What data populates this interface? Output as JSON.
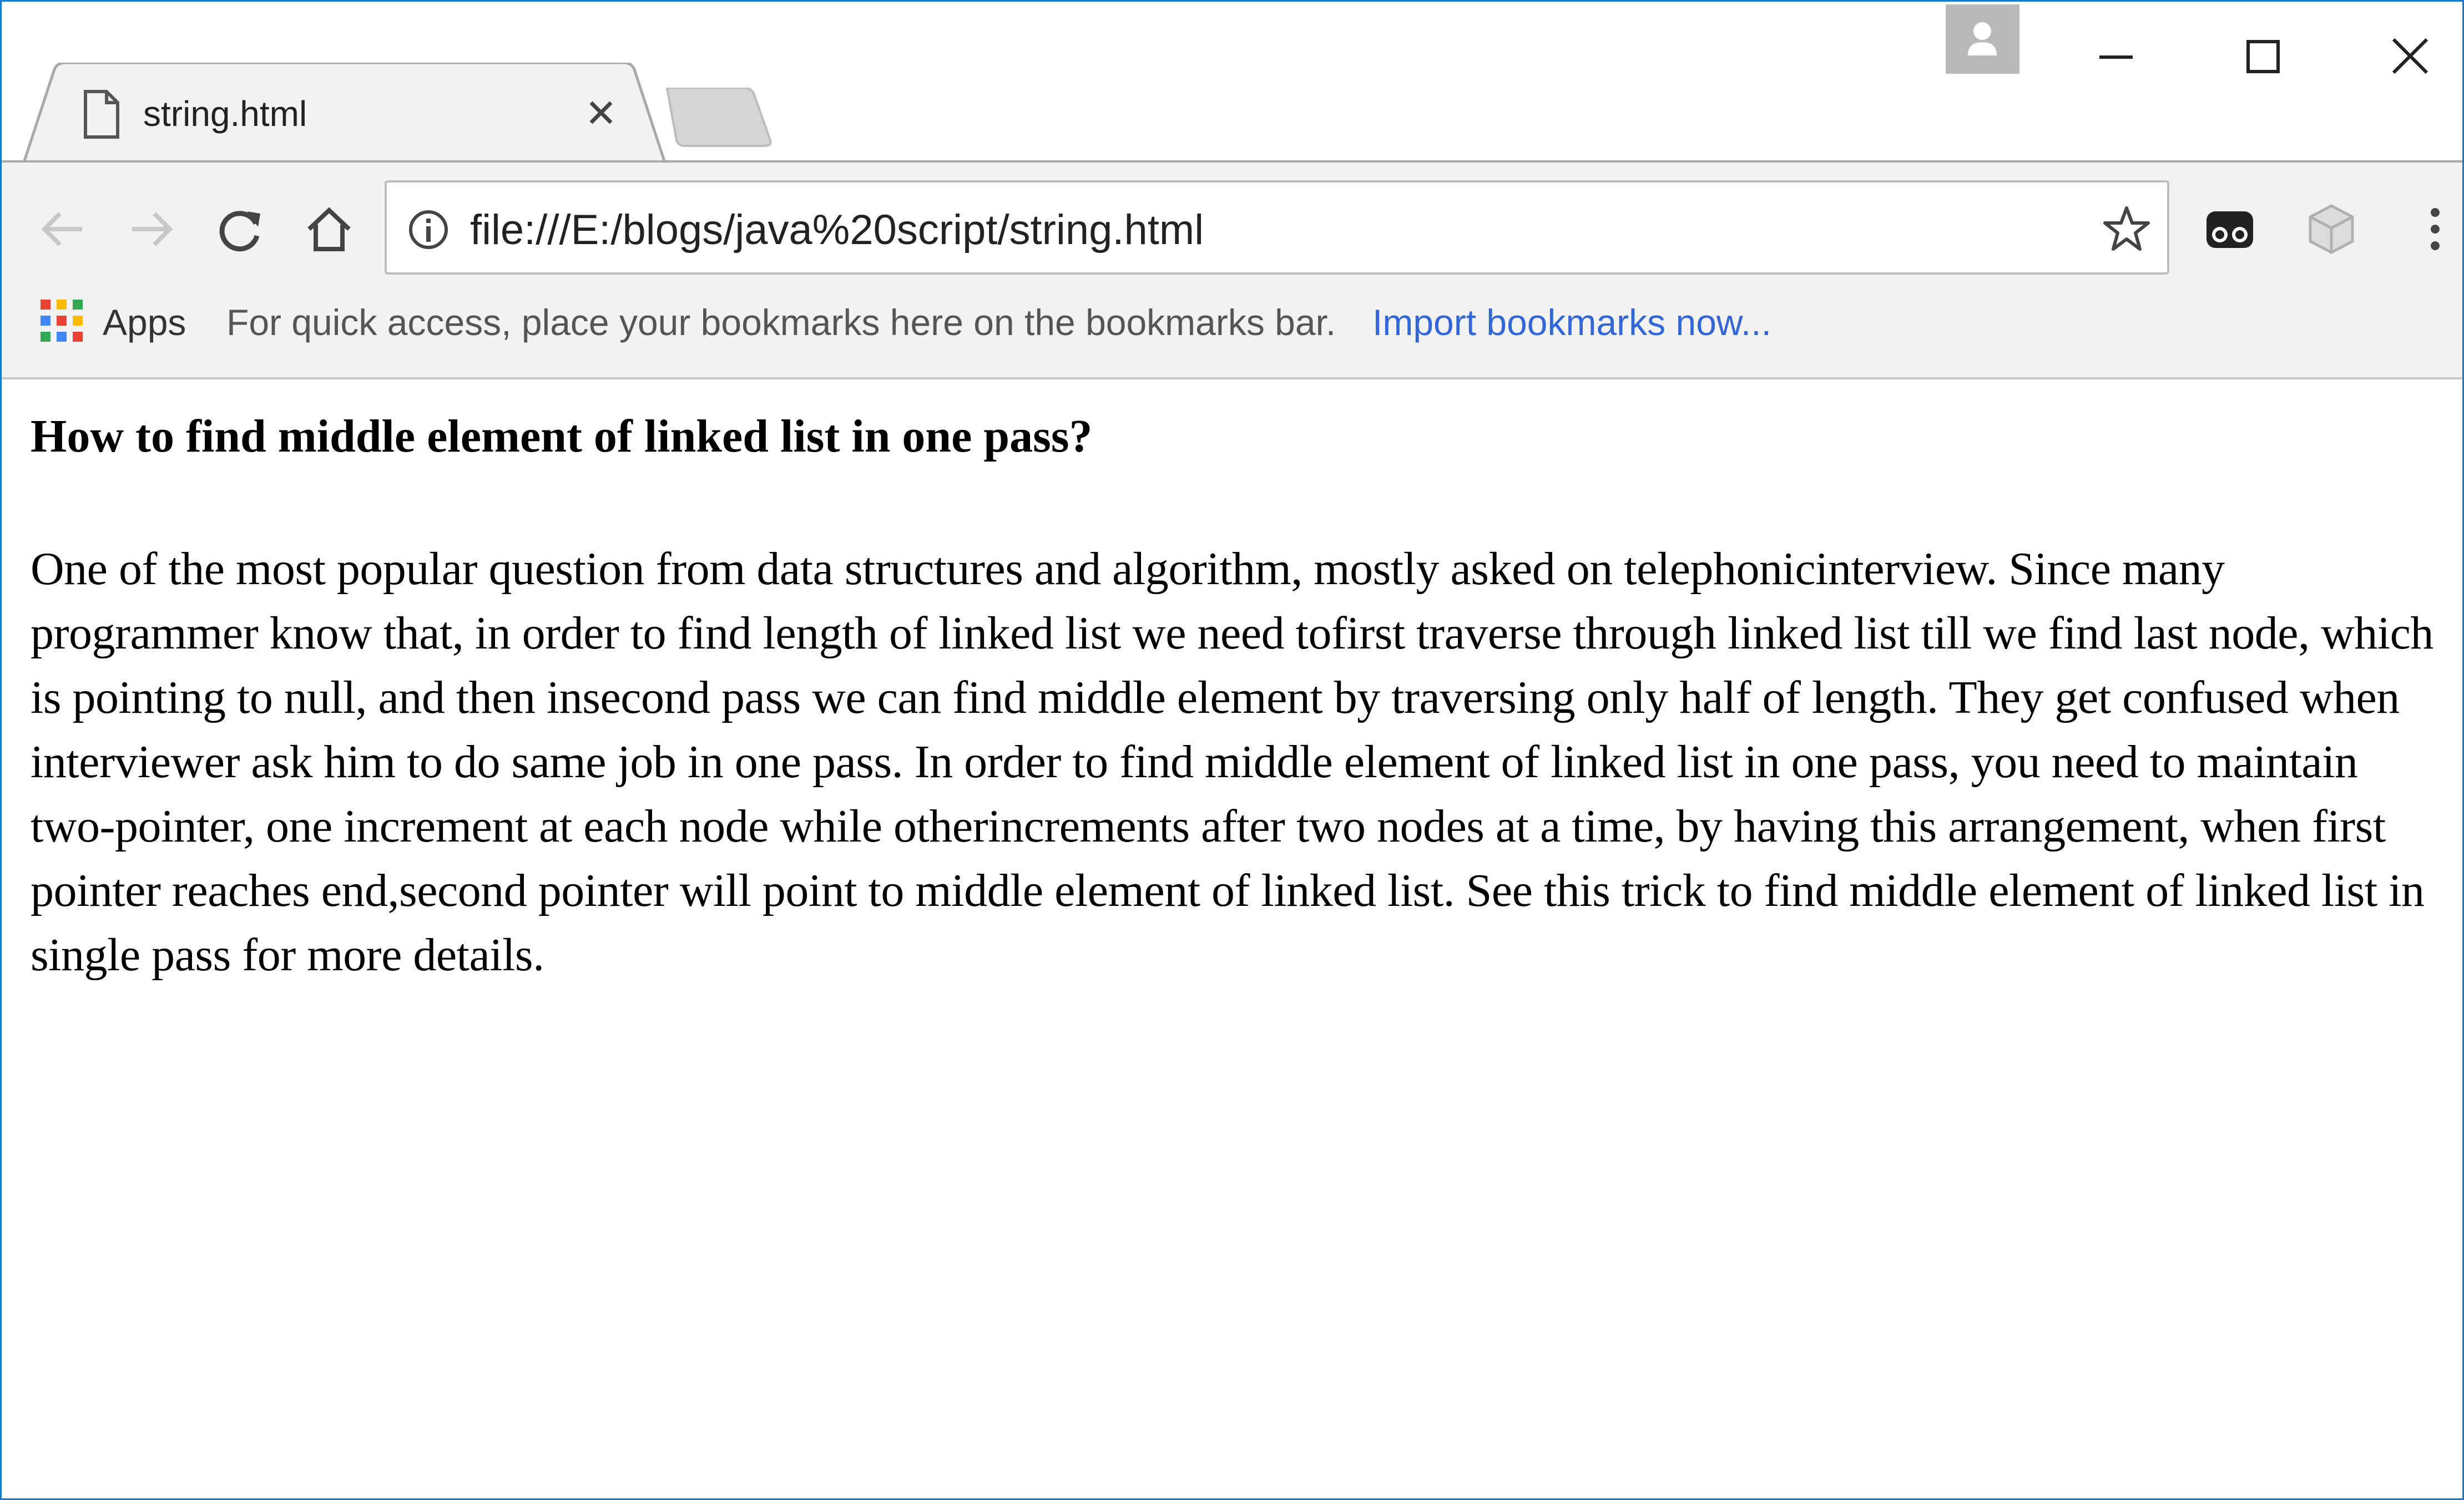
{
  "browser": {
    "tab": {
      "title": "string.html",
      "icon": "page-icon",
      "close_icon": "close-icon"
    },
    "window_controls": [
      "minimize-icon",
      "maximize-icon",
      "close-icon"
    ],
    "profile_icon": "person-icon",
    "navigation": {
      "back_icon": "arrow-left-icon",
      "forward_icon": "arrow-right-icon",
      "reload_icon": "reload-icon",
      "home_icon": "home-icon"
    },
    "address_bar": {
      "info_icon": "info-icon",
      "url": "file:///E:/blogs/java%20script/string.html",
      "bookmark_icon": "star-icon"
    },
    "extensions": [
      "incognito-extension-icon",
      "cube-extension-icon"
    ],
    "menu_icon": "more-vertical-icon",
    "bookmarks_bar": {
      "apps_label": "Apps",
      "hint": "For quick access, place your bookmarks here on the bookmarks bar.",
      "import_link": "Import bookmarks now..."
    }
  },
  "page": {
    "heading": "How to find middle element of linked list in one pass?",
    "paragraph": "One of the most popular question from data structures and algorithm, mostly asked on telephonicinterview. Since many programmer know that, in order to find length of linked list we need tofirst traverse through linked list till we find last node, which is pointing to null, and then insecond pass we can find middle element by traversing only half of length. They get confused when interviewer ask him to do same job in one pass. In order to find middle element of linked list in one pass, you need to maintain two-pointer, one increment at each node while otherincrements after two nodes at a time, by having this arrangement, when first pointer reaches end,second pointer will point to middle element of linked list. See this trick to find middle element of linked list in single pass for more details."
  },
  "colors": {
    "window_border": "#1979ca",
    "toolbar_bg": "#f2f2f2",
    "link": "#3367d6"
  }
}
